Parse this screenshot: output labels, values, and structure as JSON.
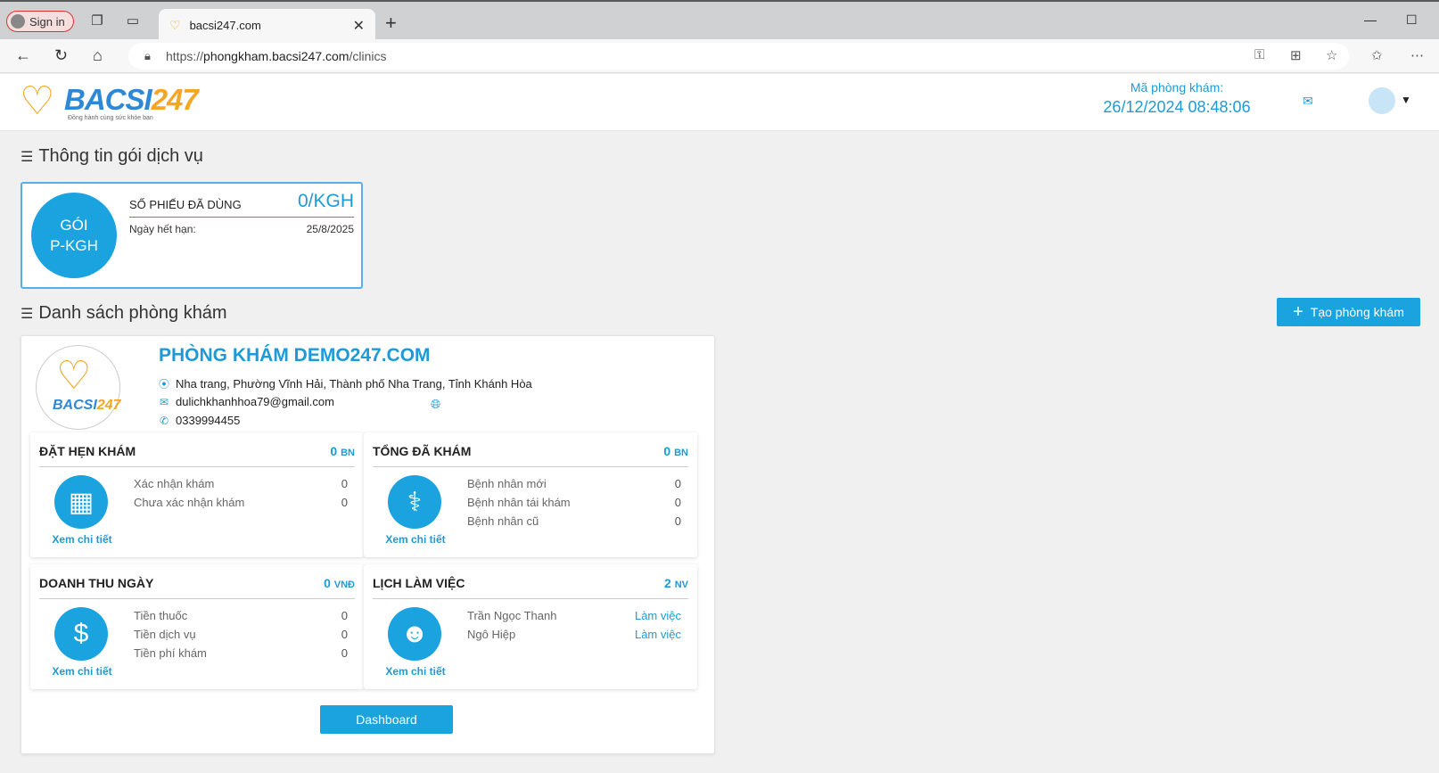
{
  "browser": {
    "signin_label": "Sign in",
    "tab_title": "bacsi247.com",
    "url_prefix": "https://",
    "url_host": "phongkham.bacsi247.com",
    "url_path": "/clinics"
  },
  "header": {
    "logo_word": "BACSI",
    "logo_num": "247",
    "logo_slogan": "Đồng hành cùng sức khỏe bạn",
    "clinic_code_label": "Mã phòng khám:",
    "datetime": "26/12/2024 08:48:06"
  },
  "package_section": {
    "title": "Thông tin gói dịch vụ",
    "badge_line1": "GÓI",
    "badge_line2": "P-KGH",
    "used_label": "SỐ PHIẾU ĐÃ DÙNG",
    "used_value": "0/KGH",
    "expiry_label": "Ngày hết hạn:",
    "expiry_value": "25/8/2025"
  },
  "clinic_section": {
    "title": "Danh sách phòng khám",
    "create_button": "Tạo phòng khám",
    "clinic": {
      "name": "PHÒNG KHÁM DEMO247.COM",
      "address": "Nha trang, Phường Vĩnh Hải, Thành phố Nha Trang, Tỉnh Khánh Hòa",
      "email": "dulichkhanhhoa79@gmail.com",
      "phone": "0339994455"
    },
    "detail_label": "Xem chi tiết",
    "dashboard_button": "Dashboard",
    "stats": {
      "appointments": {
        "title": "ĐẶT HẸN KHÁM",
        "value": "0",
        "unit": "BN",
        "rows": [
          {
            "label": "Xác nhận khám",
            "value": "0"
          },
          {
            "label": "Chưa xác nhận khám",
            "value": "0"
          }
        ]
      },
      "examined": {
        "title": "TỔNG ĐÃ KHÁM",
        "value": "0",
        "unit": "BN",
        "rows": [
          {
            "label": "Bệnh nhân mới",
            "value": "0"
          },
          {
            "label": "Bệnh nhân tái khám",
            "value": "0"
          },
          {
            "label": "Bệnh nhân cũ",
            "value": "0"
          }
        ]
      },
      "revenue": {
        "title": "DOANH THU NGÀY",
        "value": "0",
        "unit": "VNĐ",
        "rows": [
          {
            "label": "Tiền thuốc",
            "value": "0"
          },
          {
            "label": "Tiền dịch vụ",
            "value": "0"
          },
          {
            "label": "Tiền phí khám",
            "value": "0"
          }
        ]
      },
      "schedule": {
        "title": "LỊCH LÀM VIỆC",
        "value": "2",
        "unit": "NV",
        "rows": [
          {
            "label": "Trần Ngọc Thanh",
            "value": "Làm việc"
          },
          {
            "label": "Ngô Hiệp",
            "value": "Làm việc"
          }
        ]
      }
    }
  },
  "colors": {
    "accent": "#1aa3df",
    "brand_orange": "#f5a623",
    "brand_blue": "#2e88d6"
  }
}
